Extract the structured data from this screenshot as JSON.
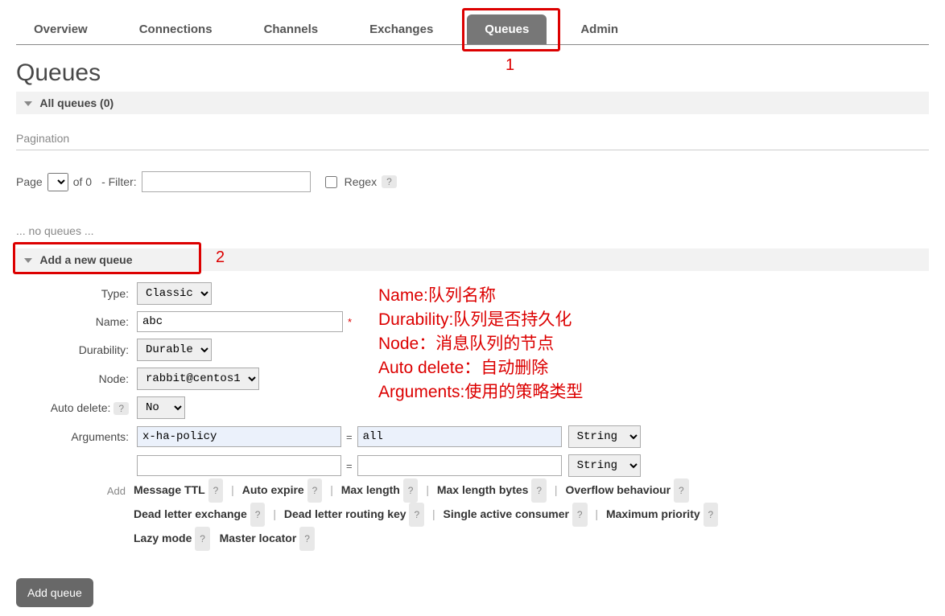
{
  "tabs": {
    "overview": "Overview",
    "connections": "Connections",
    "channels": "Channels",
    "exchanges": "Exchanges",
    "queues": "Queues",
    "admin": "Admin"
  },
  "markers": {
    "m1": "1",
    "m2": "2"
  },
  "page_title": "Queues",
  "sections": {
    "all_queues": "All queues (0)",
    "add_new_queue": "Add a new queue"
  },
  "pagination": {
    "heading": "Pagination",
    "page_label": "Page",
    "of_label": "of 0",
    "filter_label": "- Filter:",
    "filter_value": "",
    "regex_label": "Regex",
    "help": "?"
  },
  "empty_msg": "... no queues ...",
  "form": {
    "type_label": "Type:",
    "type_value": "Classic",
    "name_label": "Name:",
    "name_value": "abc",
    "required": "*",
    "durability_label": "Durability:",
    "durability_value": "Durable",
    "node_label": "Node:",
    "node_value": "rabbit@centos1",
    "autodelete_label": "Auto delete:",
    "autodelete_help": "?",
    "autodelete_value": "No",
    "arguments_label": "Arguments:",
    "arg1_key": "x-ha-policy",
    "arg1_val": "all",
    "arg1_type": "String",
    "arg2_key": "",
    "arg2_val": "",
    "arg2_type": "String",
    "eq": "=",
    "add_label": "Add"
  },
  "helpers": {
    "msg_ttl": "Message TTL",
    "auto_expire": "Auto expire",
    "max_length": "Max length",
    "max_length_bytes": "Max length bytes",
    "overflow": "Overflow behaviour",
    "dlx": "Dead letter exchange",
    "dlrk": "Dead letter routing key",
    "sac": "Single active consumer",
    "max_priority": "Maximum priority",
    "lazy": "Lazy mode",
    "master_locator": "Master locator",
    "q": "?",
    "sep": "|"
  },
  "button": {
    "add_queue": "Add queue"
  },
  "annotations": {
    "l1": "Name:队列名称",
    "l2": "Durability:队列是否持久化",
    "l3": "Node：消息队列的节点",
    "l4": "Auto delete：自动删除",
    "l5": "Arguments:使用的策略类型"
  }
}
